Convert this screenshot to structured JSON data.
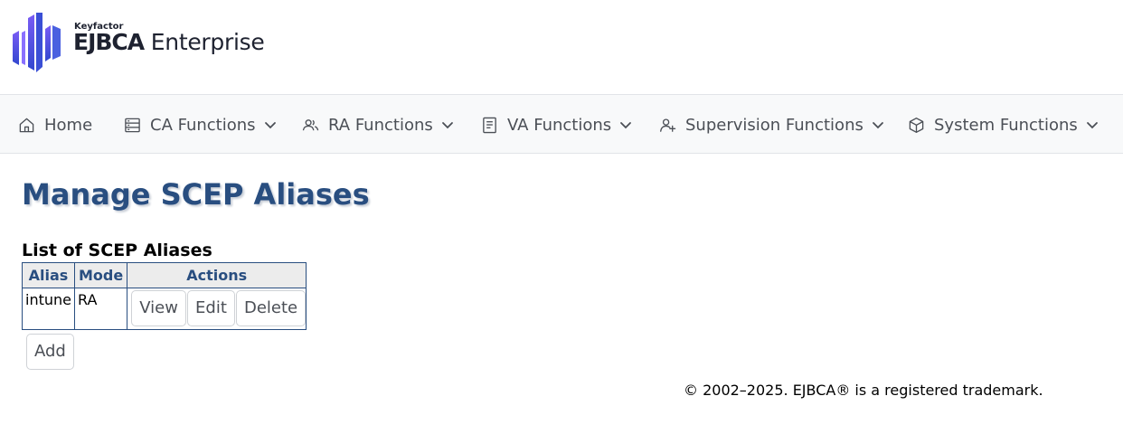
{
  "header": {
    "logo_company": "Keyfactor",
    "logo_product_bold": "EJBCA",
    "logo_product_light": "Enterprise"
  },
  "nav": {
    "items": [
      {
        "label": "Home",
        "icon": "home-icon",
        "has_dropdown": false
      },
      {
        "label": "CA Functions",
        "icon": "server-icon",
        "has_dropdown": true
      },
      {
        "label": "RA Functions",
        "icon": "users-icon",
        "has_dropdown": true
      },
      {
        "label": "VA Functions",
        "icon": "book-icon",
        "has_dropdown": true
      },
      {
        "label": "Supervision Functions",
        "icon": "user-plus-icon",
        "has_dropdown": true
      },
      {
        "label": "System Functions",
        "icon": "cube-icon",
        "has_dropdown": true
      }
    ]
  },
  "main": {
    "title": "Manage SCEP Aliases",
    "list_title": "List of SCEP Aliases",
    "table": {
      "headers": [
        "Alias",
        "Mode",
        "Actions"
      ],
      "rows": [
        {
          "alias": "intune",
          "mode": "RA",
          "actions": [
            "View",
            "Edit",
            "Delete"
          ]
        }
      ]
    },
    "add_label": "Add"
  },
  "footer": {
    "copyright": "© 2002–2025. EJBCA® is a registered trademark."
  },
  "colors": {
    "title": "#294e80",
    "nav_bg": "#f8f9fa",
    "table_border": "#294e80",
    "table_header_bg": "#ececec",
    "logo_gradient_start": "#6a4df0",
    "logo_gradient_end": "#2a40c8"
  }
}
